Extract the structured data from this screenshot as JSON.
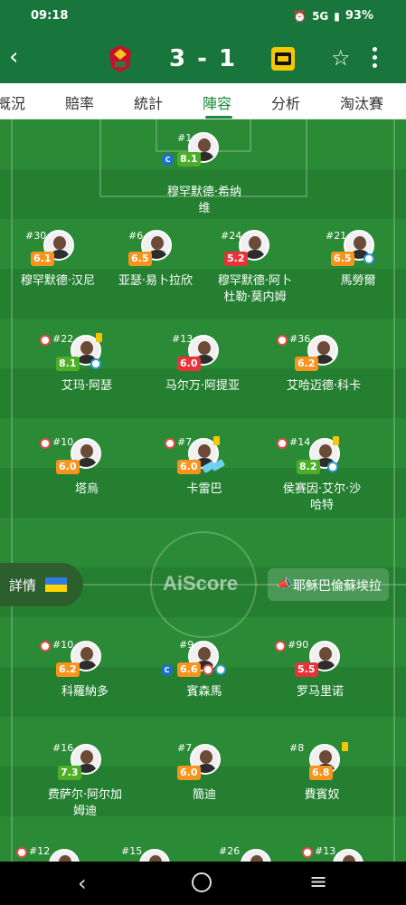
{
  "status": {
    "time": "09:18",
    "network": "5G",
    "battery": "93%",
    "alarm_icon": "alarm-icon",
    "signal_icon": "signal-icon",
    "battery_icon": "battery-icon"
  },
  "header": {
    "score": "3 - 1",
    "home_team_logo": "al-ahly-logo",
    "away_team_logo": "al-ittihad-logo"
  },
  "tabs": [
    "概況",
    "賠率",
    "統計",
    "陣容",
    "分析",
    "淘汰賽"
  ],
  "active_tab": "陣容",
  "watermark": "AiScore",
  "detail_label": "詳情",
  "coach": "耶穌巴倫蘇埃拉",
  "rating_colors": {
    "green": "#4caf27",
    "orange": "#f7941d",
    "red": "#e8313a"
  },
  "home_players": [
    {
      "num": "#1",
      "rating": "8.1",
      "name": "穆罕默德·希纳",
      "name2": "维",
      "color": "green",
      "captain": true
    },
    {
      "num": "#30",
      "rating": "6.1",
      "name": "穆罕默德·汉尼",
      "color": "orange"
    },
    {
      "num": "#6",
      "rating": "6.5",
      "name": "亚瑟·易卜拉欣",
      "color": "orange"
    },
    {
      "num": "#24",
      "rating": "5.2",
      "name": "穆罕默德·阿卜",
      "name2": "杜勒·莫内姆",
      "color": "red"
    },
    {
      "num": "#21",
      "rating": "6.5",
      "name": "馬勞爾",
      "color": "orange"
    },
    {
      "num": "#22",
      "rating": "8.1",
      "name": "艾玛·阿瑟",
      "color": "green"
    },
    {
      "num": "#13",
      "rating": "6.0",
      "name": "马尔万·阿提亚",
      "color": "red"
    },
    {
      "num": "#36",
      "rating": "6.2",
      "name": "艾哈迈德·科卡",
      "color": "orange"
    },
    {
      "num": "#10",
      "rating": "6.0",
      "name": "塔烏",
      "color": "orange"
    },
    {
      "num": "#7",
      "rating": "6.0",
      "name": "卡雷巴",
      "color": "orange"
    },
    {
      "num": "#14",
      "rating": "8.2",
      "name": "侯赛因·艾尔·沙",
      "name2": "哈特",
      "color": "green"
    }
  ],
  "away_players": [
    {
      "num": "#10",
      "rating": "6.2",
      "name": "科羅納多",
      "color": "orange"
    },
    {
      "num": "#9",
      "rating": "6.6",
      "name": "賓森馬",
      "color": "orange",
      "captain": true
    },
    {
      "num": "#90",
      "rating": "5.5",
      "name": "罗马里诺",
      "color": "red"
    },
    {
      "num": "#16",
      "rating": "7.3",
      "name": "费萨尔·阿尔加",
      "name2": "姆迪",
      "color": "green"
    },
    {
      "num": "#7",
      "rating": "6.0",
      "name": "簡迪",
      "color": "orange"
    },
    {
      "num": "#8",
      "rating": "6.8",
      "name": "費賓奴",
      "color": "orange"
    }
  ],
  "bottom_row_numbers": [
    "#12",
    "#15",
    "#26",
    "#13"
  ]
}
